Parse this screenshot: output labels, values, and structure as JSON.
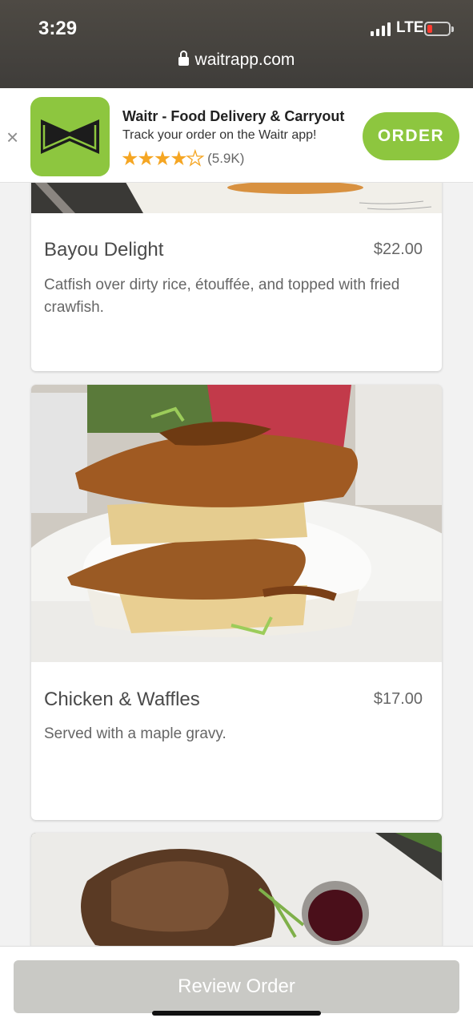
{
  "status_bar": {
    "time": "3:29",
    "network": "LTE"
  },
  "browser": {
    "url": "waitrapp.com"
  },
  "app_banner": {
    "title": "Waitr - Food Delivery & Carryout",
    "subtitle": "Track your order on the Waitr app!",
    "stars": "★★★★",
    "half_star": "★",
    "rating_count": "(5.9K)",
    "order_label": "ORDER",
    "close_label": "×",
    "brand_color": "#8dc63f"
  },
  "menu": {
    "items": [
      {
        "name": "Bayou Delight",
        "price": "$22.00",
        "description": "Catfish over dirty rice, étouffée, and topped with fried crawfish."
      },
      {
        "name": "Chicken & Waffles",
        "price": "$17.00",
        "description": "Served with a maple gravy."
      },
      {
        "name": "",
        "price": "",
        "description": ""
      }
    ]
  },
  "footer": {
    "review_label": "Review Order"
  }
}
